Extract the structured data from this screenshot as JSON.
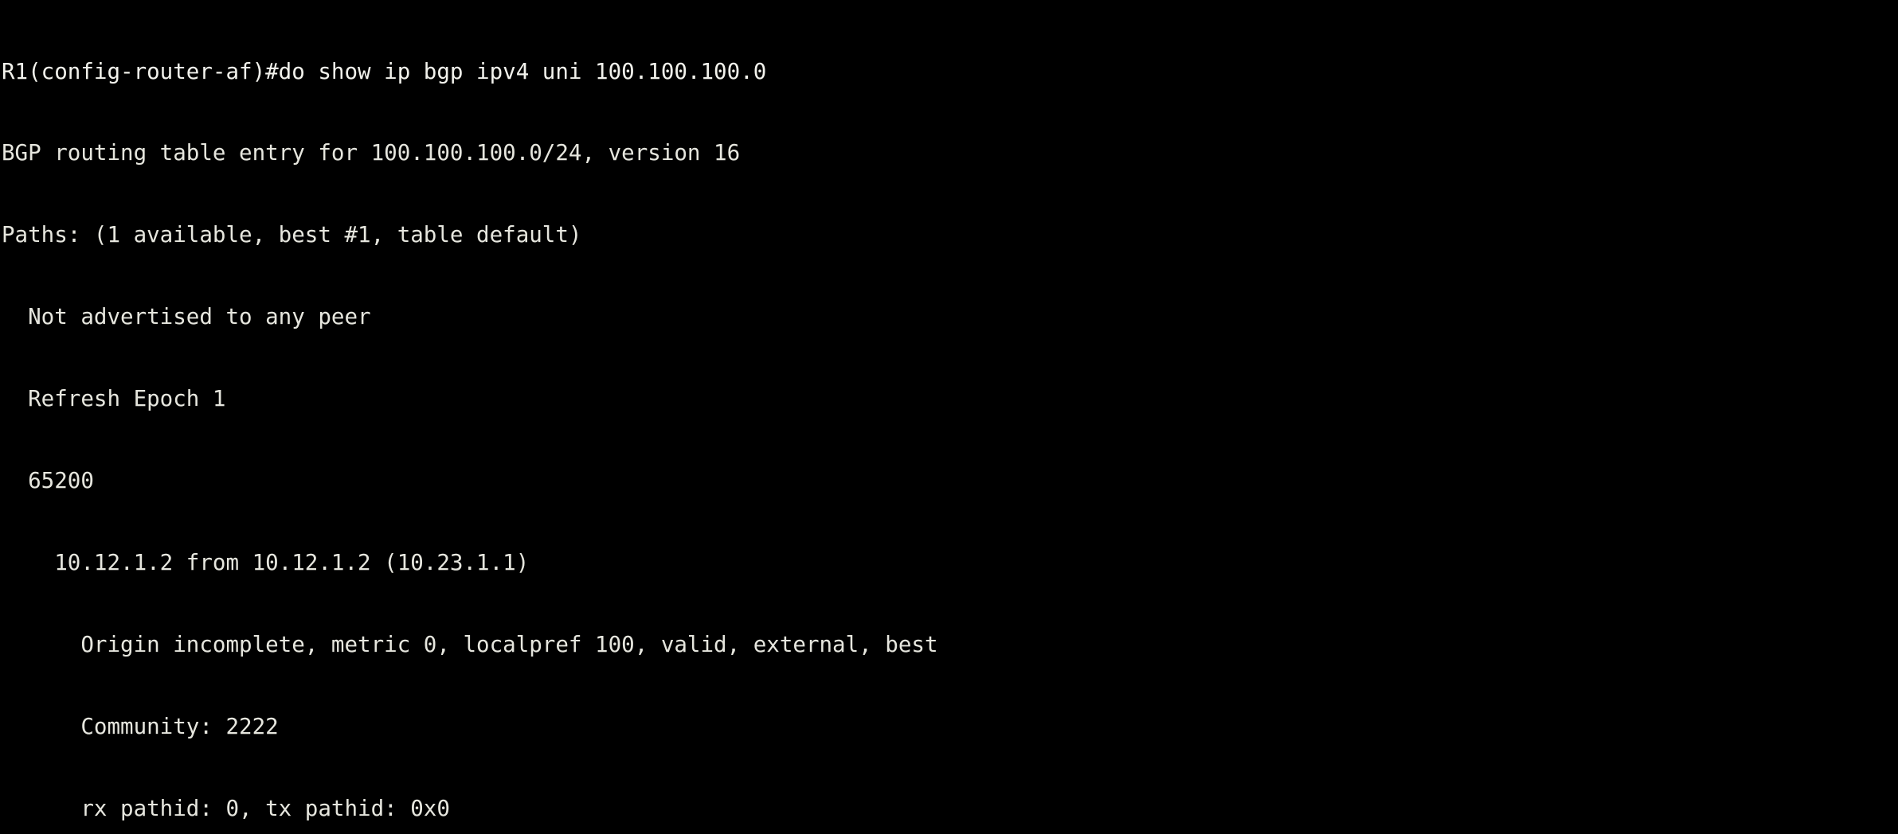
{
  "terminal": {
    "background_color": "#000000",
    "text_color": "#e9e9e2",
    "prompt": "R1(config-router-af)#",
    "command": "do show ip bgp ipv4 uni 100.100.100.0",
    "lines": [
      {
        "kind": "command",
        "text": "R1(config-router-af)#do show ip bgp ipv4 uni 100.100.100.0"
      },
      {
        "kind": "output",
        "text": "BGP routing table entry for 100.100.100.0/24, version 16"
      },
      {
        "kind": "output",
        "text": "Paths: (1 available, best #1, table default)"
      },
      {
        "kind": "output",
        "text": "  Not advertised to any peer"
      },
      {
        "kind": "output",
        "text": "  Refresh Epoch 1"
      },
      {
        "kind": "output",
        "text": "  65200"
      },
      {
        "kind": "output",
        "text": "    10.12.1.2 from 10.12.1.2 (10.23.1.1)"
      },
      {
        "kind": "output",
        "text": "      Origin incomplete, metric 0, localpref 100, valid, external, best"
      },
      {
        "kind": "output",
        "text": "      Community: 2222"
      },
      {
        "kind": "output",
        "text": "      rx pathid: 0, tx pathid: 0x0"
      }
    ],
    "details": {
      "prefix": "100.100.100.0/24",
      "version": "16",
      "paths_available": "1",
      "best_path": "#1",
      "table": "default",
      "advertised": "Not advertised to any peer",
      "refresh_epoch": "1",
      "as_path": "65200",
      "neighbor": "10.12.1.2",
      "from": "10.12.1.2",
      "router_id": "10.23.1.1",
      "origin": "incomplete",
      "metric": "0",
      "localpref": "100",
      "flags": "valid, external, best",
      "community": "2222",
      "rx_pathid": "0",
      "tx_pathid": "0x0"
    }
  }
}
